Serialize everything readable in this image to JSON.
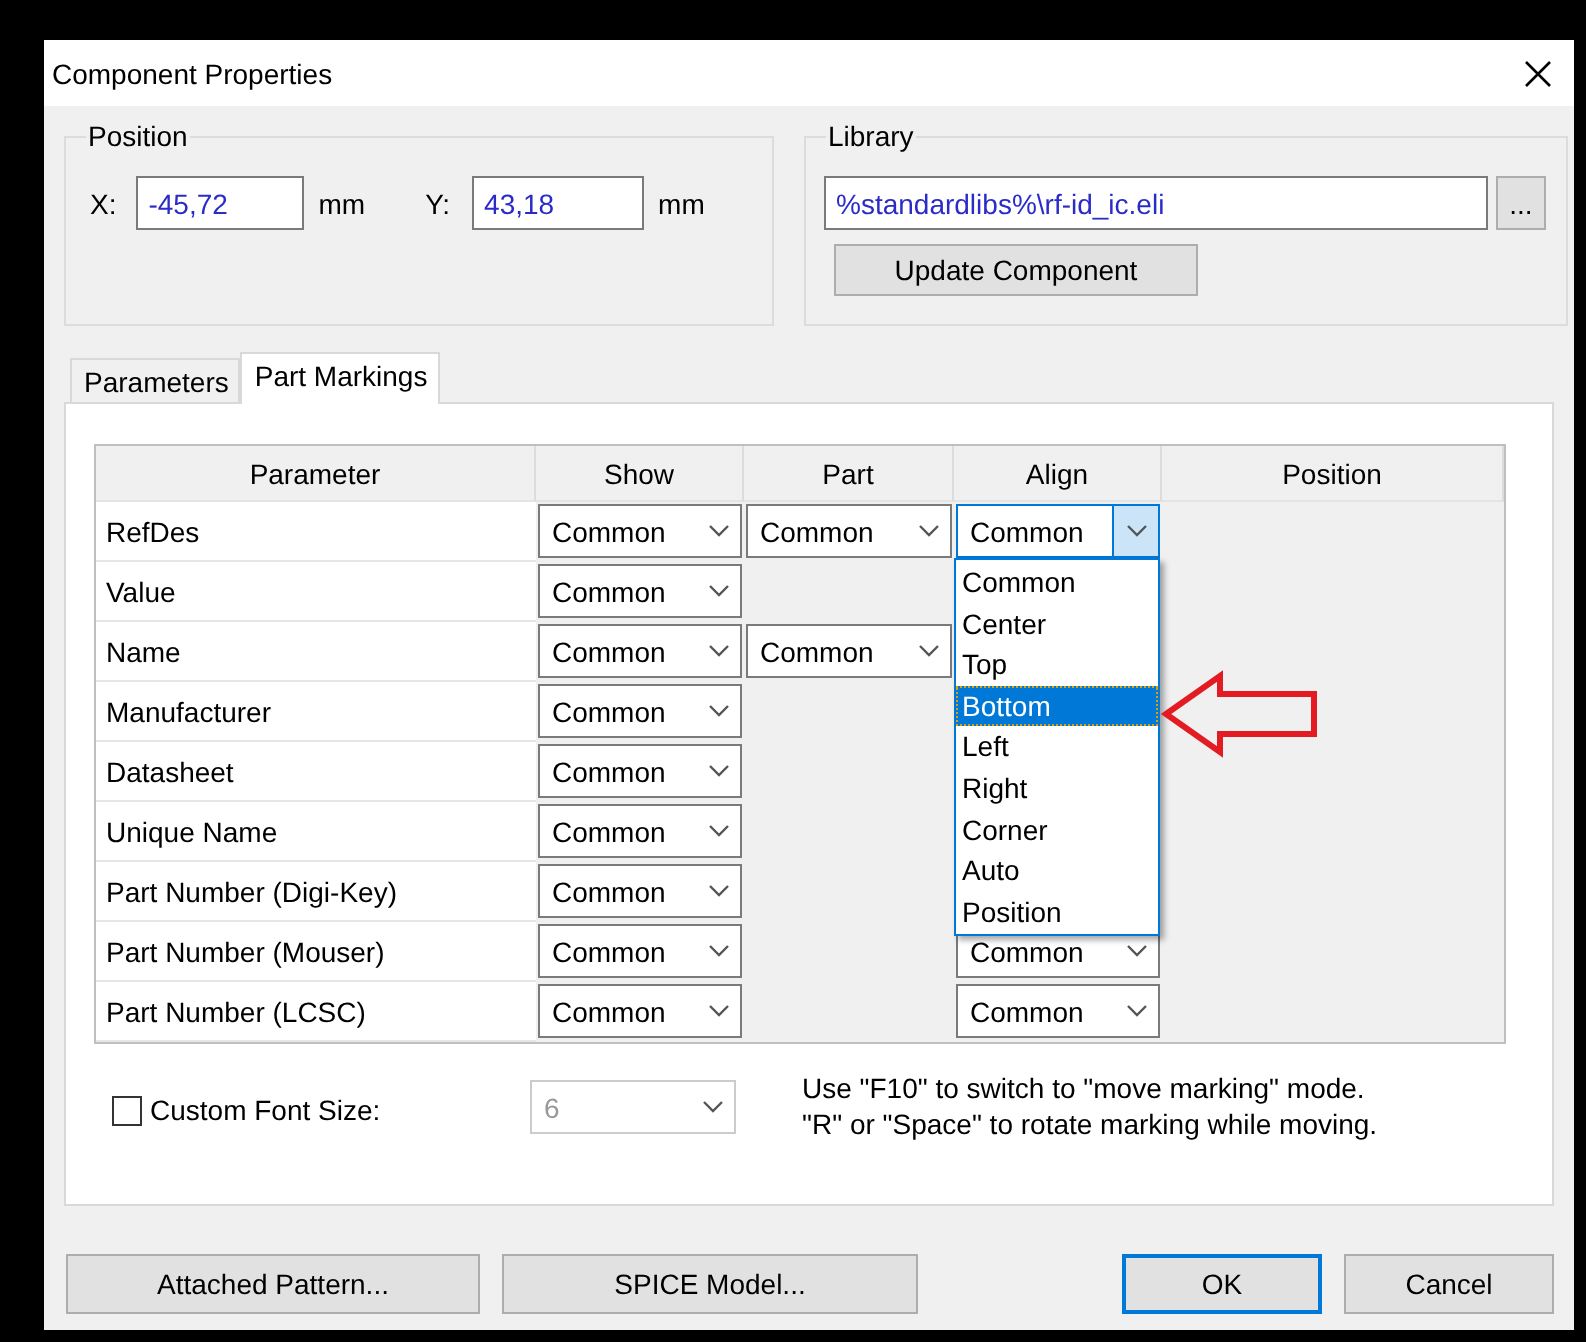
{
  "window": {
    "title": "Component Properties"
  },
  "position": {
    "label": "Position",
    "x_label": "X:",
    "x_value": "-45,72",
    "x_unit": "mm",
    "y_label": "Y:",
    "y_value": "43,18",
    "y_unit": "mm"
  },
  "library": {
    "label": "Library",
    "path": "%standardlibs%\\rf-id_ic.eli",
    "browse_button": "...",
    "update_button": "Update Component"
  },
  "tabs": [
    {
      "label": "Parameters",
      "selected": false
    },
    {
      "label": "Part Markings",
      "selected": true
    }
  ],
  "table": {
    "columns": [
      "Parameter",
      "Show",
      "Part",
      "Align",
      "Position"
    ],
    "rows": [
      {
        "parameter": "RefDes",
        "show": "Common",
        "part": "Common",
        "align": "Common",
        "align_open": true
      },
      {
        "parameter": "Value",
        "show": "Common"
      },
      {
        "parameter": "Name",
        "show": "Common",
        "part": "Common"
      },
      {
        "parameter": "Manufacturer",
        "show": "Common"
      },
      {
        "parameter": "Datasheet",
        "show": "Common"
      },
      {
        "parameter": "Unique Name",
        "show": "Common"
      },
      {
        "parameter": "Part Number (Digi-Key)",
        "show": "Common"
      },
      {
        "parameter": "Part Number (Mouser)",
        "show": "Common",
        "align": "Common",
        "align_open": false
      },
      {
        "parameter": "Part Number (LCSC)",
        "show": "Common",
        "align": "Common",
        "align_open": false
      }
    ]
  },
  "align_dropdown": {
    "items": [
      {
        "label": "Common",
        "selected": false
      },
      {
        "label": "Center",
        "selected": false
      },
      {
        "label": "Top",
        "selected": false
      },
      {
        "label": "Bottom",
        "selected": true
      },
      {
        "label": "Left",
        "selected": false
      },
      {
        "label": "Right",
        "selected": false
      },
      {
        "label": "Corner",
        "selected": false
      },
      {
        "label": "Auto",
        "selected": false
      },
      {
        "label": "Position",
        "selected": false
      }
    ]
  },
  "custom_font": {
    "label": "Custom Font Size:",
    "checked": false,
    "value": "6",
    "disabled": true
  },
  "hint": [
    "Use \"F10\" to switch to \"move marking\" mode.",
    "\"R\" or \"Space\" to rotate marking while moving."
  ],
  "buttons": [
    {
      "label": "Attached Pattern...",
      "default": false
    },
    {
      "label": "SPICE Model...",
      "default": false
    },
    {
      "label": "OK",
      "default": true
    },
    {
      "label": "Cancel",
      "default": false
    }
  ]
}
